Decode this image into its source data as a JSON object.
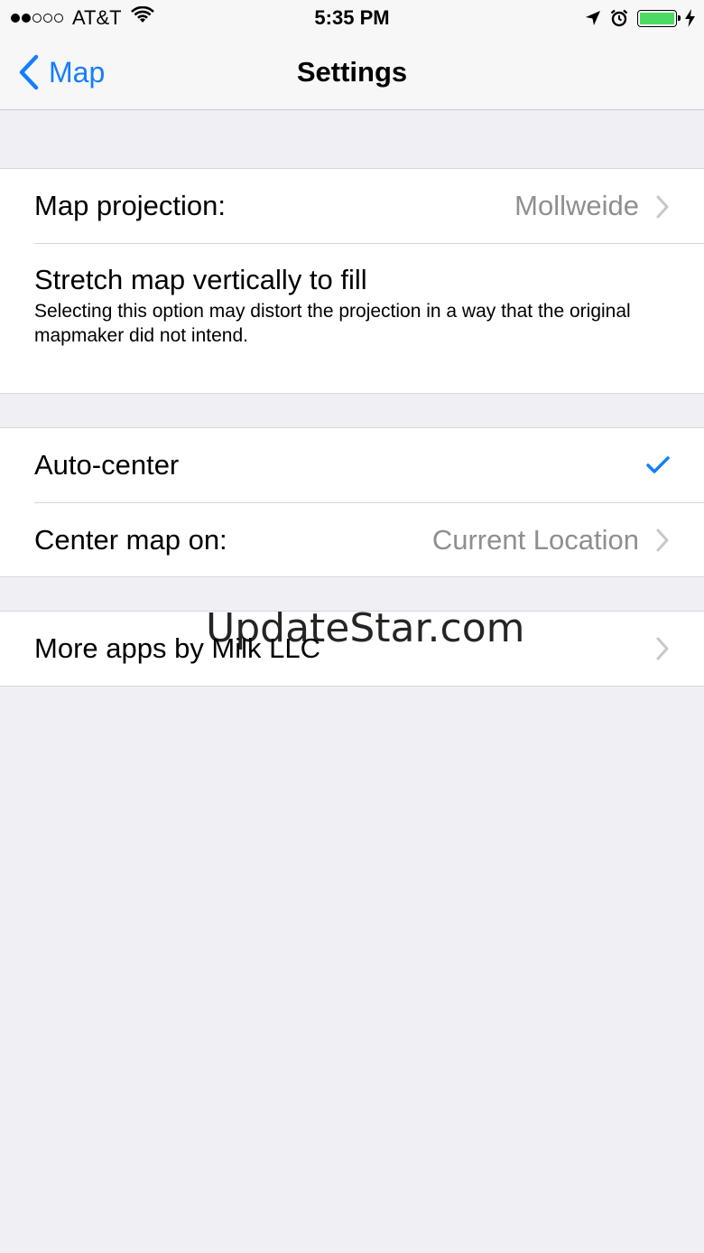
{
  "status_bar": {
    "carrier": "AT&T",
    "time": "5:35 PM",
    "signal_bars_filled": 2,
    "signal_bars_total": 5,
    "battery_color": "#4cd964",
    "icons": [
      "wifi-icon",
      "location-arrow-icon",
      "alarm-icon",
      "battery-icon",
      "charging-bolt-icon"
    ]
  },
  "nav": {
    "back_label": "Map",
    "title": "Settings",
    "accent_color": "#157efb"
  },
  "settings": {
    "map_projection": {
      "label": "Map projection:",
      "value": "Mollweide"
    },
    "stretch": {
      "label": "Stretch map vertically to fill",
      "description": "Selecting this option may distort the projection in a way that the original mapmaker did not intend."
    },
    "auto_center": {
      "label": "Auto-center",
      "checked": true
    },
    "center_map_on": {
      "label": "Center map on:",
      "value": "Current Location"
    },
    "more_apps": {
      "label": "More apps by Milk LLC"
    }
  },
  "watermark": "UpdateStar.com"
}
